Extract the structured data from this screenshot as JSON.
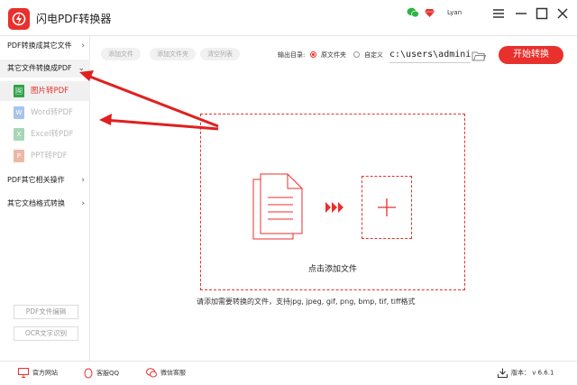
{
  "app": {
    "title": "闪电PDF转换器",
    "user": "Lyan"
  },
  "sidebar": {
    "groups": [
      {
        "label": "PDF转换成其它文件",
        "chev": "›"
      },
      {
        "label": "其它文件转换成PDF",
        "chev": "⌄"
      },
      {
        "label": "PDF其它相关操作",
        "chev": "›"
      },
      {
        "label": "其它文档格式转换",
        "chev": "›"
      }
    ],
    "items": [
      {
        "label": "图片转PDF",
        "icon": "🖼"
      },
      {
        "label": "Word转PDF",
        "icon": "W"
      },
      {
        "label": "Excel转PDF",
        "icon": "X"
      },
      {
        "label": "PPT转PDF",
        "icon": "P"
      }
    ],
    "bottom_buttons": [
      "PDF文件编辑",
      "OCR文字识别"
    ]
  },
  "toolbar": {
    "add_file": "添加文件",
    "add_folder": "添加文件夹",
    "clear_list": "清空列表",
    "output_label": "输出目录:",
    "opt_source": "原文件夹",
    "opt_custom": "自定义",
    "path_value": "c:\\users\\administ",
    "start": "开始转换"
  },
  "dropzone": {
    "label": "点击添加文件",
    "hint": "请添加需要转换的文件，支持jpg, jpeg, gif, png, bmp, tif, tiff格式"
  },
  "footer": {
    "website": "官方网站",
    "qq": "客服QQ",
    "wechat": "微信客服",
    "version": "版本： v 6.6.1"
  },
  "colors": {
    "accent": "#e8302c"
  }
}
